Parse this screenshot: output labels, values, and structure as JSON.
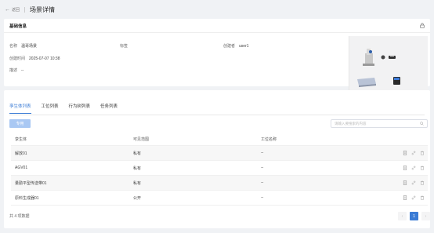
{
  "header": {
    "back_label": "返回",
    "title": "场景详情"
  },
  "basic": {
    "section_title": "基础信息",
    "name_label": "名称",
    "name_value": "温哥场景",
    "tag_label": "标签",
    "tag_value": "",
    "creator_label": "创建者",
    "creator_value": "user1",
    "created_label": "创建时间",
    "created_value": "2025-07-07 10:38",
    "desc_label": "描述",
    "desc_value": "--"
  },
  "tabs": [
    {
      "label": "孪生体列表",
      "active": true
    },
    {
      "label": "工位列表",
      "active": false
    },
    {
      "label": "行为树列表",
      "active": false
    },
    {
      "label": "任务列表",
      "active": false
    }
  ],
  "toolbar": {
    "delete_label": "专用",
    "search_placeholder": "请输入要搜索的内容"
  },
  "table": {
    "headers": [
      "孪生体",
      "可见范围",
      "工位名称"
    ],
    "rows": [
      {
        "name": "解放01",
        "scope": "私有",
        "station": "--"
      },
      {
        "name": "AGV01",
        "scope": "私有",
        "station": "--"
      },
      {
        "name": "量勤平型传送带01",
        "scope": "私有",
        "station": "--"
      },
      {
        "name": "原料生成器01",
        "scope": "公开",
        "station": "--"
      }
    ]
  },
  "footer": {
    "total": "共 4 项数据",
    "current_page": "1",
    "prev": "‹",
    "next": "›"
  },
  "colors": {
    "accent": "#3a7bd5",
    "bg": "#f0f2f5"
  }
}
